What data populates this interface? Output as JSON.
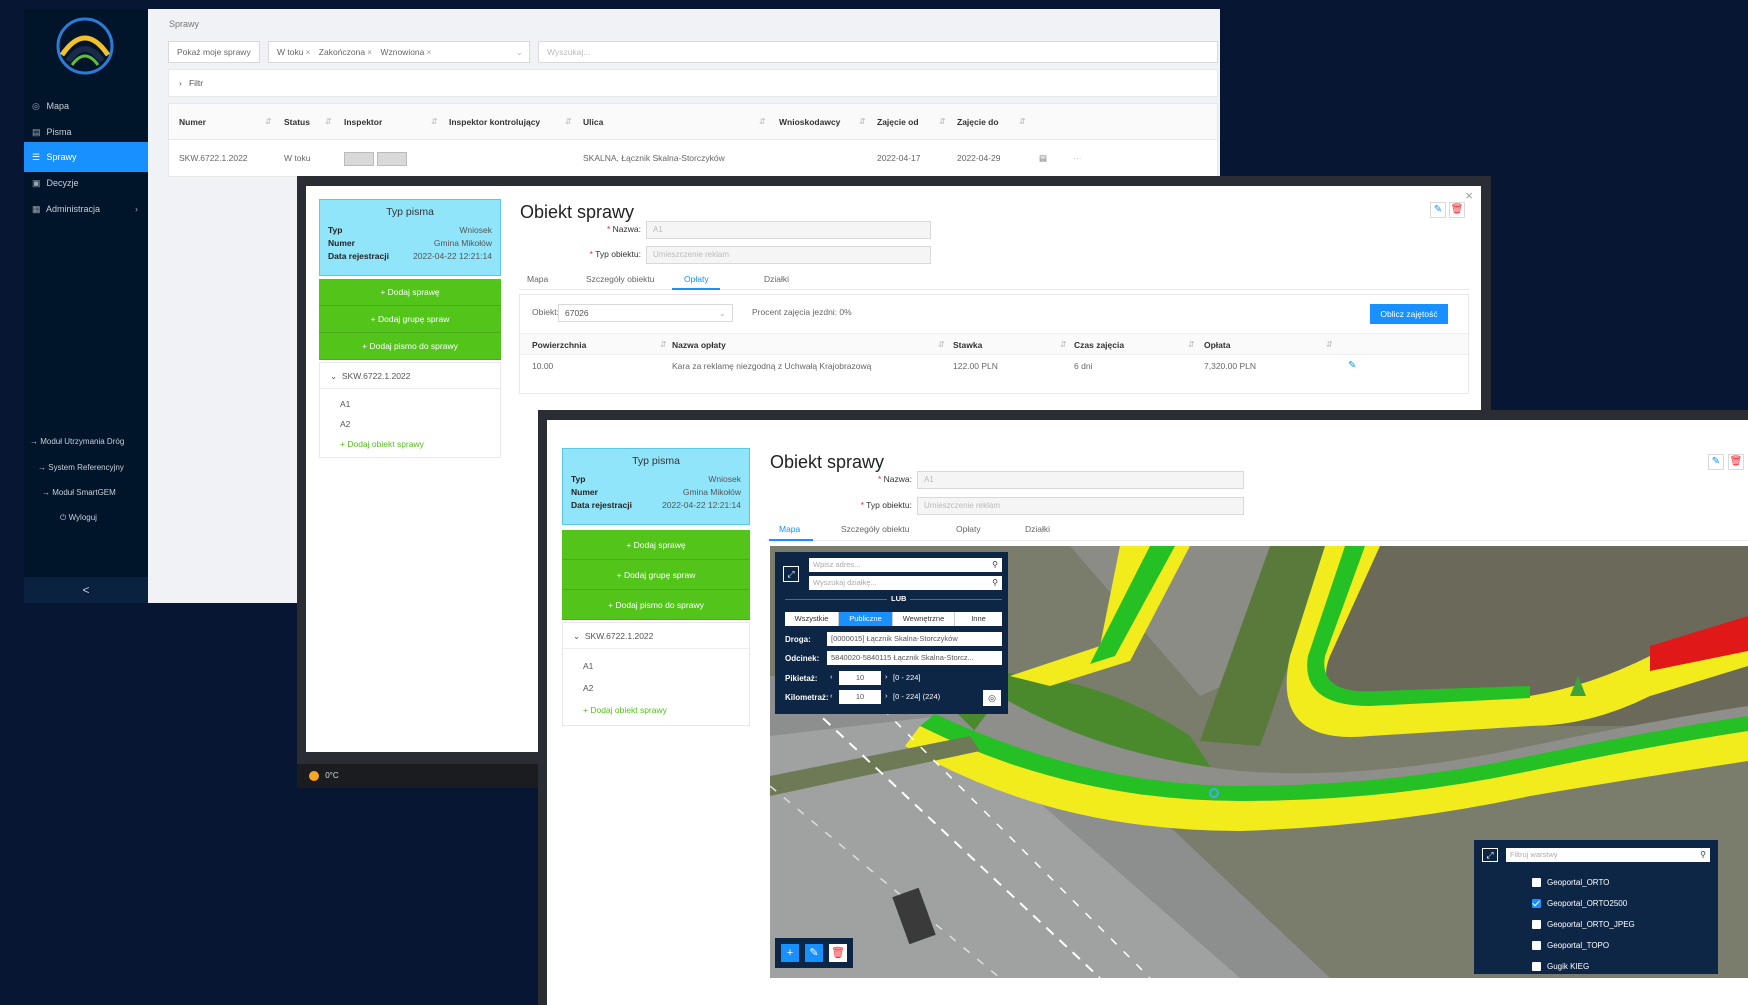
{
  "sidebar": {
    "items": [
      {
        "icon": "map-pin-icon",
        "label": "Mapa"
      },
      {
        "icon": "document-icon",
        "label": "Pisma"
      },
      {
        "icon": "list-icon",
        "label": "Sprawy"
      },
      {
        "icon": "decision-icon",
        "label": "Decyzje"
      },
      {
        "icon": "admin-icon",
        "label": "Administracja"
      }
    ],
    "modules": [
      "Moduł Utrzymania Dróg",
      "System Referencyjny",
      "Moduł SmartGEM"
    ],
    "logout": "Wyloguj",
    "collapse": "<"
  },
  "sprawy": {
    "breadcrumb": "Sprawy",
    "show_mine": "Pokaż moje sprawy",
    "tags": [
      "W toku",
      "Zakończona",
      "Wznowiona"
    ],
    "search_placeholder": "Wyszukaj...",
    "filter_label": "Filtr",
    "columns": [
      "Numer",
      "Status",
      "Inspektor",
      "Inspektor kontrolujący",
      "Ulica",
      "Wnioskodawcy",
      "Zajęcie od",
      "Zajęcie do"
    ],
    "row": {
      "numer": "SKW.6722.1.2022",
      "status": "W toku",
      "ulica": "SKALNA, Łącznik Skalna-Storczyków",
      "zajecie_od": "2022-04-17",
      "zajecie_do": "2022-04-29",
      "more": "···"
    }
  },
  "typ_pisma": {
    "title": "Typ pisma",
    "typ_label": "Typ",
    "typ_value": "Wniosek",
    "numer_label": "Numer",
    "numer_value": "Gmina Mikołów",
    "data_label": "Data rejestracji",
    "data_value": "2022-04-22 12:21:14"
  },
  "actions": {
    "add_case": "+ Dodaj sprawę",
    "add_group": "+ Dodaj grupę spraw",
    "add_letter": "+ Dodaj pismo do sprawy"
  },
  "tree": {
    "case": "SKW.6722.1.2022",
    "leaves": [
      "A1",
      "A2"
    ],
    "add_object": "+ Dodaj obiekt sprawy"
  },
  "obiekt": {
    "title": "Obiekt sprawy",
    "nazwa_label": "Nazwa:",
    "nazwa_value": "A1",
    "typ_label": "Typ obiektu:",
    "typ_value": "Umieszczenie reklam",
    "tabs": [
      "Mapa",
      "Szczegóły obiektu",
      "Opłaty",
      "Działki"
    ],
    "close": "×"
  },
  "oplaty": {
    "obiekt_label": "Obiekt:",
    "obiekt_value": "67026",
    "procent": "Procent zajęcia jezdni: 0%",
    "compute_button": "Oblicz zajętość",
    "columns": [
      "Powierzchnia",
      "Nazwa opłaty",
      "Stawka",
      "Czas zajęcia",
      "Opłata"
    ],
    "row": {
      "powierzchnia": "10.00",
      "nazwa": "Kara za reklamę niezgodną z Uchwałą Krajobrazową",
      "stawka": "122.00 PLN",
      "czas": "6 dni",
      "oplata": "7,320.00 PLN"
    }
  },
  "taskbar": {
    "temp": "0°C"
  },
  "map": {
    "address_placeholder": "Wpisz adres...",
    "parcel_placeholder": "Wyszukaj działkę...",
    "lub": "LUB",
    "segments": [
      "Wszystkie",
      "Publiczne",
      "Wewnętrzne",
      "Inne"
    ],
    "droga_label": "Droga:",
    "droga_value": "[0000015] Łącznik Skalna-Storczyków",
    "odcinek_label": "Odcinek:",
    "odcinek_value": "5840020-5840115 Łącznik Skalna-Storcz...",
    "pikietaz_label": "Pikietaż:",
    "pikietaz_value": "10",
    "pikietaz_range": "[0 - 224]",
    "kilometraz_label": "Kilometraż:",
    "kilometraz_value": "10",
    "kilometraz_range": "[0 - 224] (224)",
    "layer_filter_placeholder": "Filtruj warstwy",
    "layers": [
      {
        "name": "Geoportal_ORTO",
        "checked": false
      },
      {
        "name": "Geoportal_ORTO2500",
        "checked": true
      },
      {
        "name": "Geoportal_ORTO_JPEG",
        "checked": false
      },
      {
        "name": "Geoportal_TOPO",
        "checked": false
      },
      {
        "name": "Gugik KIEG",
        "checked": false
      }
    ]
  },
  "colors": {
    "sidebar": "#001529",
    "accent": "#1890ff",
    "green": "#52c41a",
    "cyan_card": "#91e5fb",
    "danger": "#f5222d"
  }
}
